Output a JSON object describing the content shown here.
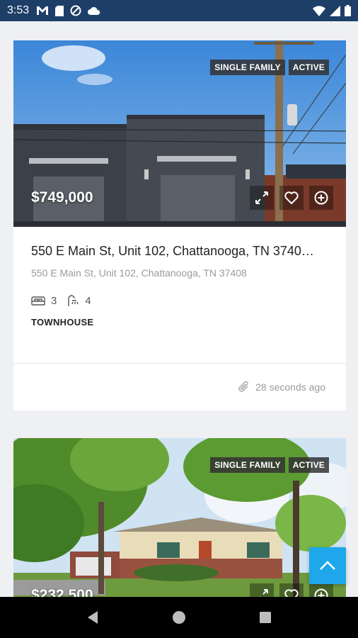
{
  "status_bar": {
    "time": "3:53"
  },
  "listings": [
    {
      "badges": [
        "SINGLE FAMILY",
        "ACTIVE"
      ],
      "price": "$749,000",
      "title": "550 E Main St, Unit 102, Chattanooga, TN 3740…",
      "address": "550 E Main St, Unit 102, Chattanooga, TN 37408",
      "beds": "3",
      "baths": "4",
      "type": "TOWNHOUSE",
      "updated": "28 seconds ago"
    },
    {
      "badges": [
        "SINGLE FAMILY",
        "ACTIVE"
      ],
      "price": "$232,500"
    }
  ],
  "colors": {
    "status_bar": "#1d3e66",
    "fab": "#1ea7ea",
    "badge_bg": "#323232"
  }
}
